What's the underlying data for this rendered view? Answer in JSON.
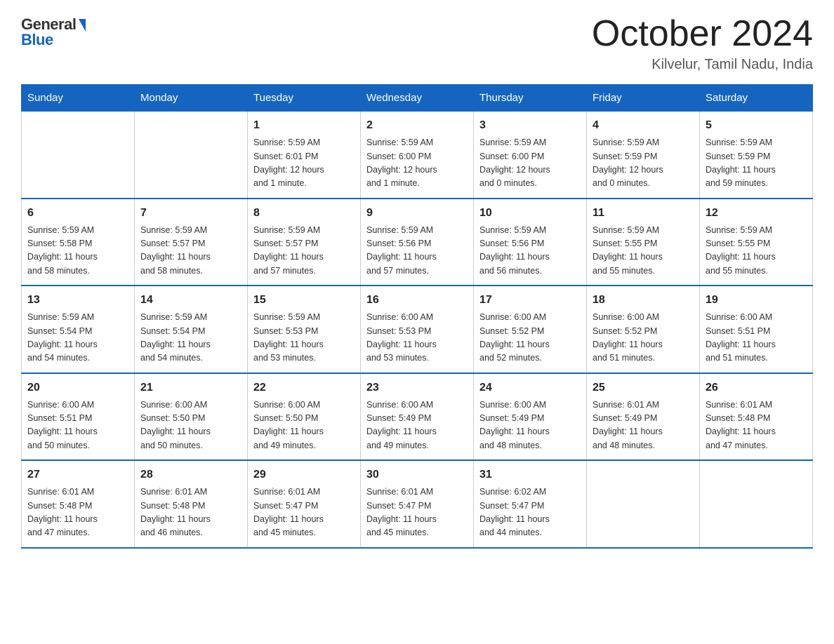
{
  "logo": {
    "general": "General",
    "blue": "Blue"
  },
  "title": "October 2024",
  "subtitle": "Kilvelur, Tamil Nadu, India",
  "days_of_week": [
    "Sunday",
    "Monday",
    "Tuesday",
    "Wednesday",
    "Thursday",
    "Friday",
    "Saturday"
  ],
  "weeks": [
    [
      {
        "day": "",
        "info": ""
      },
      {
        "day": "",
        "info": ""
      },
      {
        "day": "1",
        "info": "Sunrise: 5:59 AM\nSunset: 6:01 PM\nDaylight: 12 hours\nand 1 minute."
      },
      {
        "day": "2",
        "info": "Sunrise: 5:59 AM\nSunset: 6:00 PM\nDaylight: 12 hours\nand 1 minute."
      },
      {
        "day": "3",
        "info": "Sunrise: 5:59 AM\nSunset: 6:00 PM\nDaylight: 12 hours\nand 0 minutes."
      },
      {
        "day": "4",
        "info": "Sunrise: 5:59 AM\nSunset: 5:59 PM\nDaylight: 12 hours\nand 0 minutes."
      },
      {
        "day": "5",
        "info": "Sunrise: 5:59 AM\nSunset: 5:59 PM\nDaylight: 11 hours\nand 59 minutes."
      }
    ],
    [
      {
        "day": "6",
        "info": "Sunrise: 5:59 AM\nSunset: 5:58 PM\nDaylight: 11 hours\nand 58 minutes."
      },
      {
        "day": "7",
        "info": "Sunrise: 5:59 AM\nSunset: 5:57 PM\nDaylight: 11 hours\nand 58 minutes."
      },
      {
        "day": "8",
        "info": "Sunrise: 5:59 AM\nSunset: 5:57 PM\nDaylight: 11 hours\nand 57 minutes."
      },
      {
        "day": "9",
        "info": "Sunrise: 5:59 AM\nSunset: 5:56 PM\nDaylight: 11 hours\nand 57 minutes."
      },
      {
        "day": "10",
        "info": "Sunrise: 5:59 AM\nSunset: 5:56 PM\nDaylight: 11 hours\nand 56 minutes."
      },
      {
        "day": "11",
        "info": "Sunrise: 5:59 AM\nSunset: 5:55 PM\nDaylight: 11 hours\nand 55 minutes."
      },
      {
        "day": "12",
        "info": "Sunrise: 5:59 AM\nSunset: 5:55 PM\nDaylight: 11 hours\nand 55 minutes."
      }
    ],
    [
      {
        "day": "13",
        "info": "Sunrise: 5:59 AM\nSunset: 5:54 PM\nDaylight: 11 hours\nand 54 minutes."
      },
      {
        "day": "14",
        "info": "Sunrise: 5:59 AM\nSunset: 5:54 PM\nDaylight: 11 hours\nand 54 minutes."
      },
      {
        "day": "15",
        "info": "Sunrise: 5:59 AM\nSunset: 5:53 PM\nDaylight: 11 hours\nand 53 minutes."
      },
      {
        "day": "16",
        "info": "Sunrise: 6:00 AM\nSunset: 5:53 PM\nDaylight: 11 hours\nand 53 minutes."
      },
      {
        "day": "17",
        "info": "Sunrise: 6:00 AM\nSunset: 5:52 PM\nDaylight: 11 hours\nand 52 minutes."
      },
      {
        "day": "18",
        "info": "Sunrise: 6:00 AM\nSunset: 5:52 PM\nDaylight: 11 hours\nand 51 minutes."
      },
      {
        "day": "19",
        "info": "Sunrise: 6:00 AM\nSunset: 5:51 PM\nDaylight: 11 hours\nand 51 minutes."
      }
    ],
    [
      {
        "day": "20",
        "info": "Sunrise: 6:00 AM\nSunset: 5:51 PM\nDaylight: 11 hours\nand 50 minutes."
      },
      {
        "day": "21",
        "info": "Sunrise: 6:00 AM\nSunset: 5:50 PM\nDaylight: 11 hours\nand 50 minutes."
      },
      {
        "day": "22",
        "info": "Sunrise: 6:00 AM\nSunset: 5:50 PM\nDaylight: 11 hours\nand 49 minutes."
      },
      {
        "day": "23",
        "info": "Sunrise: 6:00 AM\nSunset: 5:49 PM\nDaylight: 11 hours\nand 49 minutes."
      },
      {
        "day": "24",
        "info": "Sunrise: 6:00 AM\nSunset: 5:49 PM\nDaylight: 11 hours\nand 48 minutes."
      },
      {
        "day": "25",
        "info": "Sunrise: 6:01 AM\nSunset: 5:49 PM\nDaylight: 11 hours\nand 48 minutes."
      },
      {
        "day": "26",
        "info": "Sunrise: 6:01 AM\nSunset: 5:48 PM\nDaylight: 11 hours\nand 47 minutes."
      }
    ],
    [
      {
        "day": "27",
        "info": "Sunrise: 6:01 AM\nSunset: 5:48 PM\nDaylight: 11 hours\nand 47 minutes."
      },
      {
        "day": "28",
        "info": "Sunrise: 6:01 AM\nSunset: 5:48 PM\nDaylight: 11 hours\nand 46 minutes."
      },
      {
        "day": "29",
        "info": "Sunrise: 6:01 AM\nSunset: 5:47 PM\nDaylight: 11 hours\nand 45 minutes."
      },
      {
        "day": "30",
        "info": "Sunrise: 6:01 AM\nSunset: 5:47 PM\nDaylight: 11 hours\nand 45 minutes."
      },
      {
        "day": "31",
        "info": "Sunrise: 6:02 AM\nSunset: 5:47 PM\nDaylight: 11 hours\nand 44 minutes."
      },
      {
        "day": "",
        "info": ""
      },
      {
        "day": "",
        "info": ""
      }
    ]
  ]
}
